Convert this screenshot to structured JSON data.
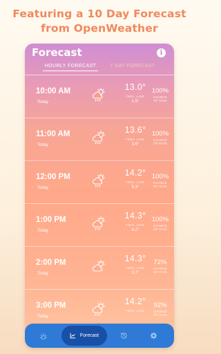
{
  "promo": {
    "line1": "Featuring a 10 Day Forecast",
    "line2": "from OpenWeather"
  },
  "header": {
    "title": "Forecast",
    "info_icon": "info-icon"
  },
  "tabs": [
    {
      "label": "HOURLY FORECAST",
      "active": true
    },
    {
      "label": "7 DAY FORECAST",
      "active": false
    }
  ],
  "forecast": {
    "feels_like_label": "FEEL LIKE",
    "rain_label_1": "CHANCE",
    "rain_label_2": "OF RAIN",
    "hours": [
      {
        "time": "10:00 AM",
        "day": "Today",
        "temp": "13.0°",
        "feels": "1.5°",
        "rain": "100%",
        "icon": "cloud-rain-sun-icon"
      },
      {
        "time": "11:00 AM",
        "day": "Today",
        "temp": "13.6°",
        "feels": "3.6°",
        "rain": "100%",
        "icon": "cloud-rain-sun-icon"
      },
      {
        "time": "12:00 PM",
        "day": "Today",
        "temp": "14.2°",
        "feels": "5.3°",
        "rain": "100%",
        "icon": "cloud-rain-sun-icon"
      },
      {
        "time": "1:00 PM",
        "day": "Today",
        "temp": "14.3°",
        "feels": "4.2°",
        "rain": "100%",
        "icon": "cloud-rain-sun-icon"
      },
      {
        "time": "2:00 PM",
        "day": "Today",
        "temp": "14.3°",
        "feels": "3.7°",
        "rain": "72%",
        "icon": "cloud-sun-icon"
      },
      {
        "time": "3:00 PM",
        "day": "Today",
        "temp": "14.2°",
        "feels": "",
        "rain": "92%",
        "icon": "cloud-rain-sun-icon"
      }
    ]
  },
  "nav": {
    "items": [
      {
        "icon": "sun-icon"
      },
      {
        "icon": "chart-icon",
        "label": "Forecast",
        "active": true
      },
      {
        "icon": "history-icon"
      },
      {
        "icon": "gear-icon"
      }
    ]
  },
  "colors": {
    "promo": "#f0895e",
    "nav": "#2e7ad6",
    "nav_active": "#184fa7"
  }
}
